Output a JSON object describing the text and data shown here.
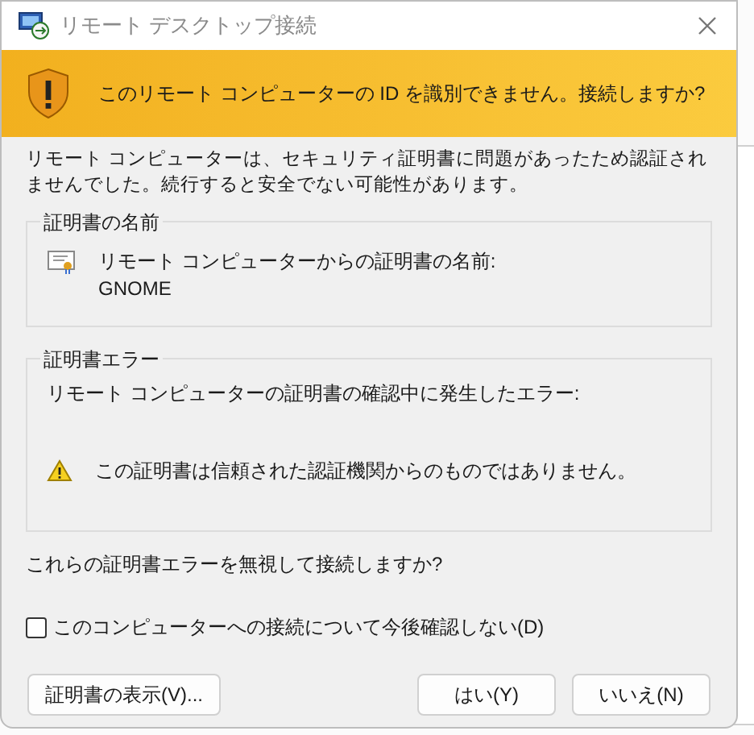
{
  "window": {
    "title": "リモート デスクトップ接続"
  },
  "banner": {
    "text": "このリモート コンピューターの ID を識別できません。接続しますか?"
  },
  "description": "リモート コンピューターは、セキュリティ証明書に問題があったため認証されませんでした。続行すると安全でない可能性があります。",
  "certificate_name": {
    "legend": "証明書の名前",
    "label": "リモート コンピューターからの証明書の名前:",
    "value": "GNOME"
  },
  "certificate_errors": {
    "legend": "証明書エラー",
    "intro": "リモート コンピューターの証明書の確認中に発生したエラー:",
    "errors": [
      "この証明書は信頼された認証機関からのものではありません。"
    ]
  },
  "question": "これらの証明書エラーを無視して接続しますか?",
  "dont_ask_again": {
    "label": "このコンピューターへの接続について今後確認しない(D)",
    "checked": false
  },
  "buttons": [
    {
      "label": "証明書の表示(V)...",
      "kind": "left"
    },
    {
      "label": "はい(Y)",
      "kind": "right"
    },
    {
      "label": "いいえ(N)",
      "kind": "right"
    }
  ]
}
